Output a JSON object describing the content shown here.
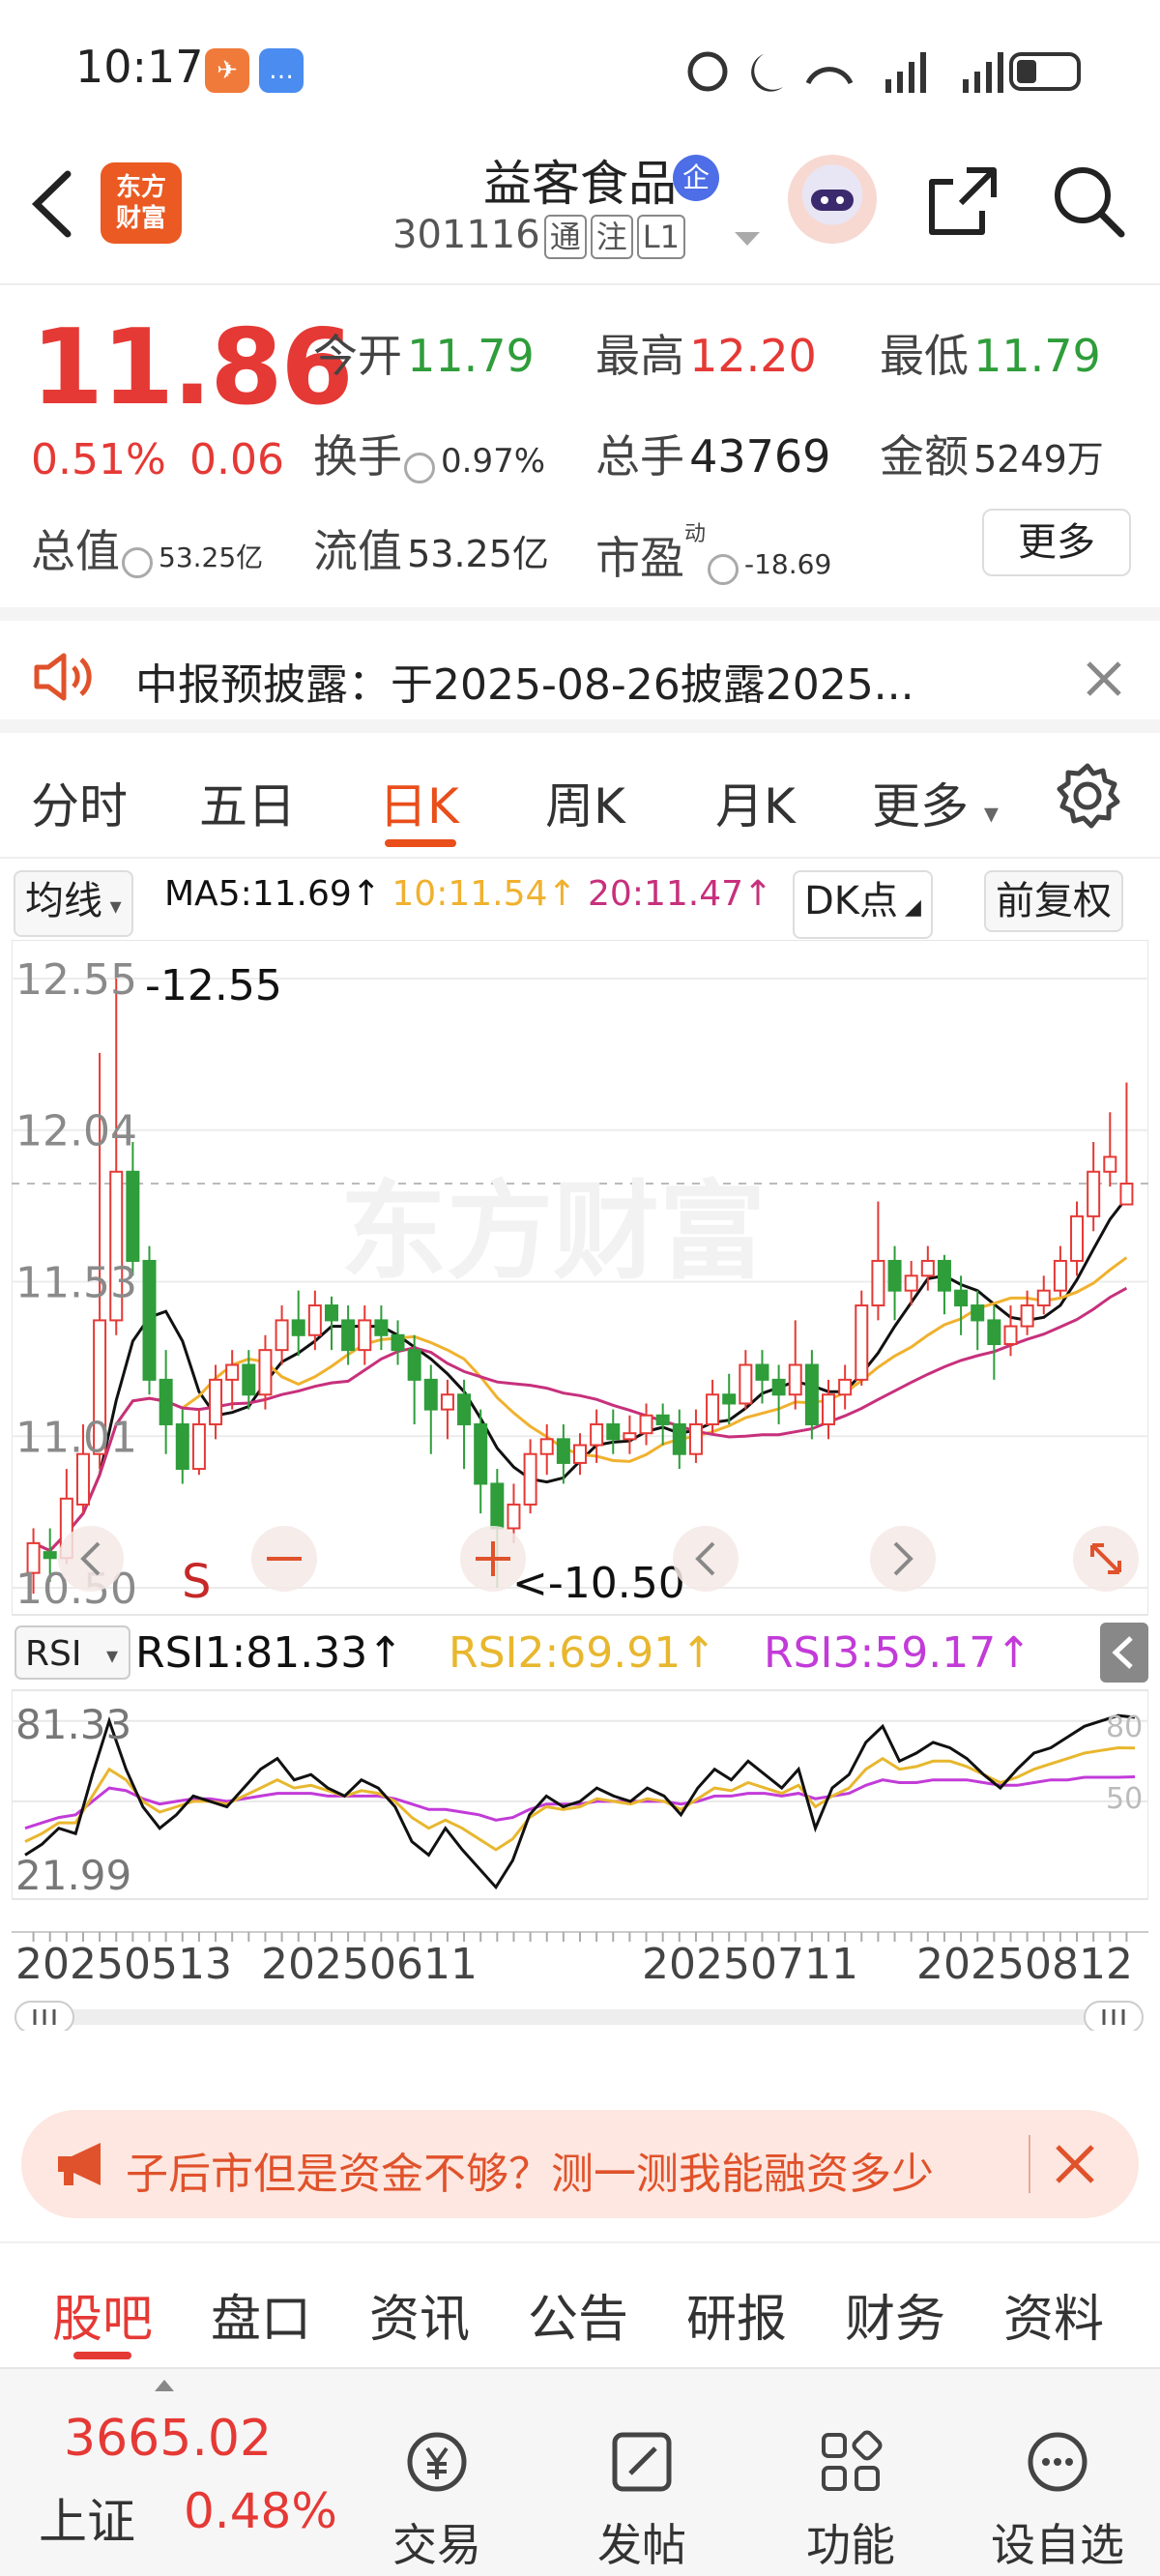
{
  "status_bar": {
    "time": "10:17"
  },
  "header": {
    "logo_text_line1": "东方",
    "logo_text_line2": "财富",
    "stock_name": "益客食品",
    "badge": "企",
    "stock_code": "301116",
    "tags": [
      "通",
      "注",
      "L1"
    ]
  },
  "quote": {
    "price": "11.86",
    "change_pct": "0.51%",
    "change_abs": "0.06",
    "open_label": "今开",
    "open": "11.79",
    "high_label": "最高",
    "high": "12.20",
    "low_label": "最低",
    "low": "11.79",
    "turnover_label": "换手",
    "turnover": "0.97%",
    "volume_label": "总手",
    "volume": "43769",
    "amount_label": "金额",
    "amount": "5249万",
    "mktcap_label": "总值",
    "mktcap": "53.25亿",
    "float_label": "流值",
    "float_cap": "53.25亿",
    "pe_label": "市盈",
    "pe_sup": "动",
    "pe": "-18.69",
    "more_label": "更多"
  },
  "notice": {
    "text": "中报预披露：于2025-08-26披露2025..."
  },
  "kline_tabs": {
    "items": [
      "分时",
      "五日",
      "日K",
      "周K",
      "月K",
      "更多"
    ],
    "active": "日K"
  },
  "ma_bar": {
    "indicator": "均线",
    "ma5": "MA5:11.69↑",
    "ma10": "10:11.54↑",
    "ma20": "20:11.47↑",
    "dk_label": "DK点",
    "adjust_label": "前复权"
  },
  "chart_data": {
    "type": "candlestick",
    "price_axis": {
      "ticks": [
        "12.55",
        "12.04",
        "11.53",
        "11.01",
        "10.50"
      ],
      "ylim": [
        10.5,
        12.55
      ]
    },
    "annotations": {
      "high": "-12.55",
      "low": "<-10.50",
      "s_label": "S"
    },
    "candles": [
      [
        10.55,
        10.65,
        10.48,
        10.7
      ],
      [
        10.62,
        10.6,
        10.52,
        10.7
      ],
      [
        10.6,
        10.8,
        10.58,
        10.9
      ],
      [
        10.78,
        10.95,
        10.75,
        11.05
      ],
      [
        10.95,
        11.4,
        10.9,
        12.3
      ],
      [
        11.4,
        11.9,
        11.35,
        12.55
      ],
      [
        11.9,
        11.6,
        11.55,
        12.0
      ],
      [
        11.6,
        11.2,
        11.15,
        11.65
      ],
      [
        11.2,
        11.05,
        10.95,
        11.3
      ],
      [
        11.05,
        10.9,
        10.85,
        11.1
      ],
      [
        10.9,
        11.05,
        10.88,
        11.1
      ],
      [
        11.05,
        11.2,
        11.0,
        11.25
      ],
      [
        11.2,
        11.25,
        11.1,
        11.3
      ],
      [
        11.25,
        11.15,
        11.1,
        11.3
      ],
      [
        11.15,
        11.3,
        11.1,
        11.35
      ],
      [
        11.3,
        11.4,
        11.25,
        11.45
      ],
      [
        11.4,
        11.35,
        11.28,
        11.5
      ],
      [
        11.35,
        11.45,
        11.3,
        11.5
      ],
      [
        11.45,
        11.4,
        11.3,
        11.48
      ],
      [
        11.4,
        11.3,
        11.25,
        11.45
      ],
      [
        11.3,
        11.4,
        11.25,
        11.45
      ],
      [
        11.4,
        11.35,
        11.3,
        11.45
      ],
      [
        11.35,
        11.3,
        11.25,
        11.4
      ],
      [
        11.3,
        11.2,
        11.05,
        11.35
      ],
      [
        11.2,
        11.1,
        10.95,
        11.25
      ],
      [
        11.1,
        11.15,
        11.0,
        11.2
      ],
      [
        11.15,
        11.05,
        10.9,
        11.2
      ],
      [
        11.05,
        10.85,
        10.75,
        11.1
      ],
      [
        10.85,
        10.7,
        10.5,
        10.9
      ],
      [
        10.7,
        10.78,
        10.65,
        10.85
      ],
      [
        10.78,
        10.95,
        10.75,
        11.0
      ],
      [
        10.95,
        11.0,
        10.88,
        11.05
      ],
      [
        11.0,
        10.92,
        10.85,
        11.05
      ],
      [
        10.92,
        10.98,
        10.88,
        11.02
      ],
      [
        10.98,
        11.05,
        10.92,
        11.1
      ],
      [
        11.05,
        11.0,
        10.95,
        11.1
      ],
      [
        11.0,
        11.02,
        10.95,
        11.08
      ],
      [
        11.02,
        11.08,
        10.98,
        11.12
      ],
      [
        11.08,
        11.05,
        10.98,
        11.12
      ],
      [
        11.05,
        10.95,
        10.9,
        11.1
      ],
      [
        10.95,
        11.05,
        10.92,
        11.1
      ],
      [
        11.05,
        11.15,
        11.02,
        11.2
      ],
      [
        11.15,
        11.12,
        11.05,
        11.22
      ],
      [
        11.12,
        11.25,
        11.1,
        11.3
      ],
      [
        11.25,
        11.2,
        11.12,
        11.3
      ],
      [
        11.2,
        11.15,
        11.05,
        11.25
      ],
      [
        11.15,
        11.25,
        11.1,
        11.4
      ],
      [
        11.25,
        11.05,
        11.0,
        11.3
      ],
      [
        11.05,
        11.15,
        11.0,
        11.2
      ],
      [
        11.15,
        11.2,
        11.1,
        11.25
      ],
      [
        11.2,
        11.45,
        11.18,
        11.5
      ],
      [
        11.45,
        11.6,
        11.4,
        11.8
      ],
      [
        11.6,
        11.5,
        11.4,
        11.65
      ],
      [
        11.5,
        11.55,
        11.45,
        11.6
      ],
      [
        11.55,
        11.6,
        11.5,
        11.65
      ],
      [
        11.6,
        11.5,
        11.42,
        11.62
      ],
      [
        11.5,
        11.45,
        11.35,
        11.55
      ],
      [
        11.45,
        11.4,
        11.3,
        11.5
      ],
      [
        11.4,
        11.32,
        11.2,
        11.45
      ],
      [
        11.32,
        11.38,
        11.28,
        11.45
      ],
      [
        11.38,
        11.45,
        11.35,
        11.5
      ],
      [
        11.45,
        11.5,
        11.42,
        11.55
      ],
      [
        11.5,
        11.6,
        11.48,
        11.65
      ],
      [
        11.6,
        11.75,
        11.55,
        11.8
      ],
      [
        11.75,
        11.9,
        11.7,
        12.0
      ],
      [
        11.9,
        11.95,
        11.85,
        12.1
      ],
      [
        11.79,
        11.86,
        11.79,
        12.2
      ]
    ],
    "rsi_axis": {
      "ticks": [
        "81.33",
        "21.99"
      ],
      "guides": [
        "80",
        "50"
      ]
    },
    "rsi1": [
      30,
      34,
      40,
      38,
      60,
      80,
      62,
      48,
      40,
      45,
      52,
      50,
      48,
      55,
      62,
      66,
      58,
      60,
      55,
      52,
      58,
      55,
      48,
      35,
      30,
      40,
      32,
      25,
      18,
      28,
      45,
      52,
      48,
      50,
      55,
      52,
      50,
      55,
      52,
      45,
      55,
      62,
      58,
      65,
      60,
      55,
      62,
      40,
      55,
      60,
      72,
      78,
      65,
      68,
      72,
      70,
      66,
      60,
      55,
      62,
      68,
      70,
      74,
      78,
      80,
      82,
      81.33
    ],
    "rsi2": [
      35,
      38,
      42,
      42,
      52,
      62,
      58,
      50,
      46,
      48,
      50,
      50,
      49,
      52,
      55,
      58,
      55,
      56,
      54,
      52,
      54,
      53,
      50,
      44,
      40,
      43,
      40,
      36,
      32,
      36,
      44,
      48,
      47,
      48,
      51,
      50,
      49,
      51,
      50,
      47,
      51,
      55,
      54,
      57,
      55,
      53,
      56,
      48,
      52,
      55,
      62,
      66,
      62,
      63,
      65,
      65,
      63,
      60,
      57,
      59,
      62,
      64,
      66,
      68,
      69,
      70,
      69.91
    ],
    "rsi3": [
      40,
      42,
      44,
      45,
      50,
      55,
      54,
      51,
      49,
      50,
      51,
      51,
      50,
      51,
      52,
      53,
      53,
      53,
      52,
      52,
      52,
      52,
      51,
      49,
      47,
      47,
      46,
      45,
      43,
      44,
      47,
      49,
      49,
      49,
      50,
      50,
      50,
      50,
      50,
      49,
      50,
      52,
      52,
      53,
      53,
      52,
      53,
      51,
      52,
      53,
      56,
      58,
      57,
      57,
      58,
      58,
      58,
      57,
      56,
      56,
      57,
      58,
      58,
      59,
      59,
      59,
      59.17
    ],
    "rsi_label": "RSI",
    "rsi1_text": "RSI1:81.33↑",
    "rsi2_text": "RSI2:69.91↑",
    "rsi3_text": "RSI3:59.17↑",
    "dates": [
      "20250513",
      "20250611",
      "20250711",
      "20250812"
    ],
    "colors": {
      "up": "#e53935",
      "down": "#2e9d3a",
      "ma5": "#111111",
      "ma10": "#f0b12e",
      "ma20": "#c7307c"
    }
  },
  "ad": {
    "text": "子后市但是资金不够？测一测我能融资多少"
  },
  "section_tabs": {
    "items": [
      "股吧",
      "盘口",
      "资讯",
      "公告",
      "研报",
      "财务",
      "资料"
    ],
    "active": "股吧"
  },
  "bottom_bar": {
    "index_value": "3665.02",
    "index_name": "上证",
    "index_change": "0.48%",
    "items": [
      {
        "label": "交易",
        "icon": "yen-circle-icon"
      },
      {
        "label": "发帖",
        "icon": "edit-icon"
      },
      {
        "label": "功能",
        "icon": "grid-icon"
      },
      {
        "label": "设自选",
        "icon": "more-circle-icon"
      }
    ]
  }
}
